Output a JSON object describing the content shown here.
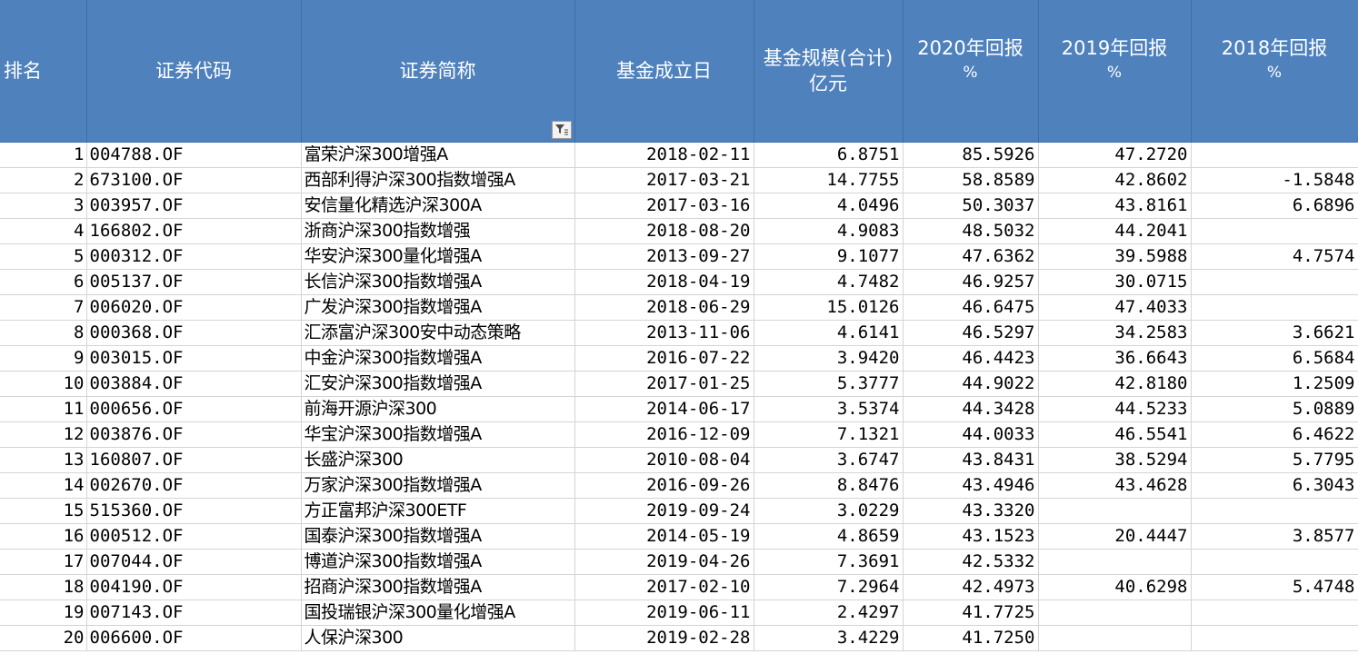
{
  "headers": {
    "rank": "排名",
    "code": "证券代码",
    "name": "证券简称",
    "inception": "基金成立日",
    "size_line1": "基金规模(合计)",
    "size_line2": "亿元",
    "r2020_line1": "2020年回报",
    "r2020_line2": "%",
    "r2019_line1": "2019年回报",
    "r2019_line2": "%",
    "r2018_line1": "2018年回报",
    "r2018_line2": "%"
  },
  "rows": [
    {
      "rank": "1",
      "code": "004788.OF",
      "name": "富荣沪深300增强A",
      "inception": "2018-02-11",
      "size": "6.8751",
      "r2020": "85.5926",
      "r2019": "47.2720",
      "r2018": ""
    },
    {
      "rank": "2",
      "code": "673100.OF",
      "name": "西部利得沪深300指数增强A",
      "inception": "2017-03-21",
      "size": "14.7755",
      "r2020": "58.8589",
      "r2019": "42.8602",
      "r2018": "-1.5848"
    },
    {
      "rank": "3",
      "code": "003957.OF",
      "name": "安信量化精选沪深300A",
      "inception": "2017-03-16",
      "size": "4.0496",
      "r2020": "50.3037",
      "r2019": "43.8161",
      "r2018": "6.6896"
    },
    {
      "rank": "4",
      "code": "166802.OF",
      "name": "浙商沪深300指数增强",
      "inception": "2018-08-20",
      "size": "4.9083",
      "r2020": "48.5032",
      "r2019": "44.2041",
      "r2018": ""
    },
    {
      "rank": "5",
      "code": "000312.OF",
      "name": "华安沪深300量化增强A",
      "inception": "2013-09-27",
      "size": "9.1077",
      "r2020": "47.6362",
      "r2019": "39.5988",
      "r2018": "4.7574"
    },
    {
      "rank": "6",
      "code": "005137.OF",
      "name": "长信沪深300指数增强A",
      "inception": "2018-04-19",
      "size": "4.7482",
      "r2020": "46.9257",
      "r2019": "30.0715",
      "r2018": ""
    },
    {
      "rank": "7",
      "code": "006020.OF",
      "name": "广发沪深300指数增强A",
      "inception": "2018-06-29",
      "size": "15.0126",
      "r2020": "46.6475",
      "r2019": "47.4033",
      "r2018": ""
    },
    {
      "rank": "8",
      "code": "000368.OF",
      "name": "汇添富沪深300安中动态策略",
      "inception": "2013-11-06",
      "size": "4.6141",
      "r2020": "46.5297",
      "r2019": "34.2583",
      "r2018": "3.6621"
    },
    {
      "rank": "9",
      "code": "003015.OF",
      "name": "中金沪深300指数增强A",
      "inception": "2016-07-22",
      "size": "3.9420",
      "r2020": "46.4423",
      "r2019": "36.6643",
      "r2018": "6.5684"
    },
    {
      "rank": "10",
      "code": "003884.OF",
      "name": "汇安沪深300指数增强A",
      "inception": "2017-01-25",
      "size": "5.3777",
      "r2020": "44.9022",
      "r2019": "42.8180",
      "r2018": "1.2509"
    },
    {
      "rank": "11",
      "code": "000656.OF",
      "name": "前海开源沪深300",
      "inception": "2014-06-17",
      "size": "3.5374",
      "r2020": "44.3428",
      "r2019": "44.5233",
      "r2018": "5.0889"
    },
    {
      "rank": "12",
      "code": "003876.OF",
      "name": "华宝沪深300指数增强A",
      "inception": "2016-12-09",
      "size": "7.1321",
      "r2020": "44.0033",
      "r2019": "46.5541",
      "r2018": "6.4622"
    },
    {
      "rank": "13",
      "code": "160807.OF",
      "name": "长盛沪深300",
      "inception": "2010-08-04",
      "size": "3.6747",
      "r2020": "43.8431",
      "r2019": "38.5294",
      "r2018": "5.7795"
    },
    {
      "rank": "14",
      "code": "002670.OF",
      "name": "万家沪深300指数增强A",
      "inception": "2016-09-26",
      "size": "8.8476",
      "r2020": "43.4946",
      "r2019": "43.4628",
      "r2018": "6.3043"
    },
    {
      "rank": "15",
      "code": "515360.OF",
      "name": "方正富邦沪深300ETF",
      "inception": "2019-09-24",
      "size": "3.0229",
      "r2020": "43.3320",
      "r2019": "",
      "r2018": ""
    },
    {
      "rank": "16",
      "code": "000512.OF",
      "name": "国泰沪深300指数增强A",
      "inception": "2014-05-19",
      "size": "4.8659",
      "r2020": "43.1523",
      "r2019": "20.4447",
      "r2018": "3.8577"
    },
    {
      "rank": "17",
      "code": "007044.OF",
      "name": "博道沪深300指数增强A",
      "inception": "2019-04-26",
      "size": "7.3691",
      "r2020": "42.5332",
      "r2019": "",
      "r2018": ""
    },
    {
      "rank": "18",
      "code": "004190.OF",
      "name": "招商沪深300指数增强A",
      "inception": "2017-02-10",
      "size": "7.2964",
      "r2020": "42.4973",
      "r2019": "40.6298",
      "r2018": "5.4748"
    },
    {
      "rank": "19",
      "code": "007143.OF",
      "name": "国投瑞银沪深300量化增强A",
      "inception": "2019-06-11",
      "size": "2.4297",
      "r2020": "41.7725",
      "r2019": "",
      "r2018": ""
    },
    {
      "rank": "20",
      "code": "006600.OF",
      "name": "人保沪深300",
      "inception": "2019-02-28",
      "size": "3.4229",
      "r2020": "41.7250",
      "r2019": "",
      "r2018": ""
    }
  ],
  "icons": {
    "filter": "filter-funnel-icon"
  },
  "colors": {
    "header_bg": "#4f81bd",
    "header_text": "#ffffff",
    "grid": "#d4d4d4"
  }
}
